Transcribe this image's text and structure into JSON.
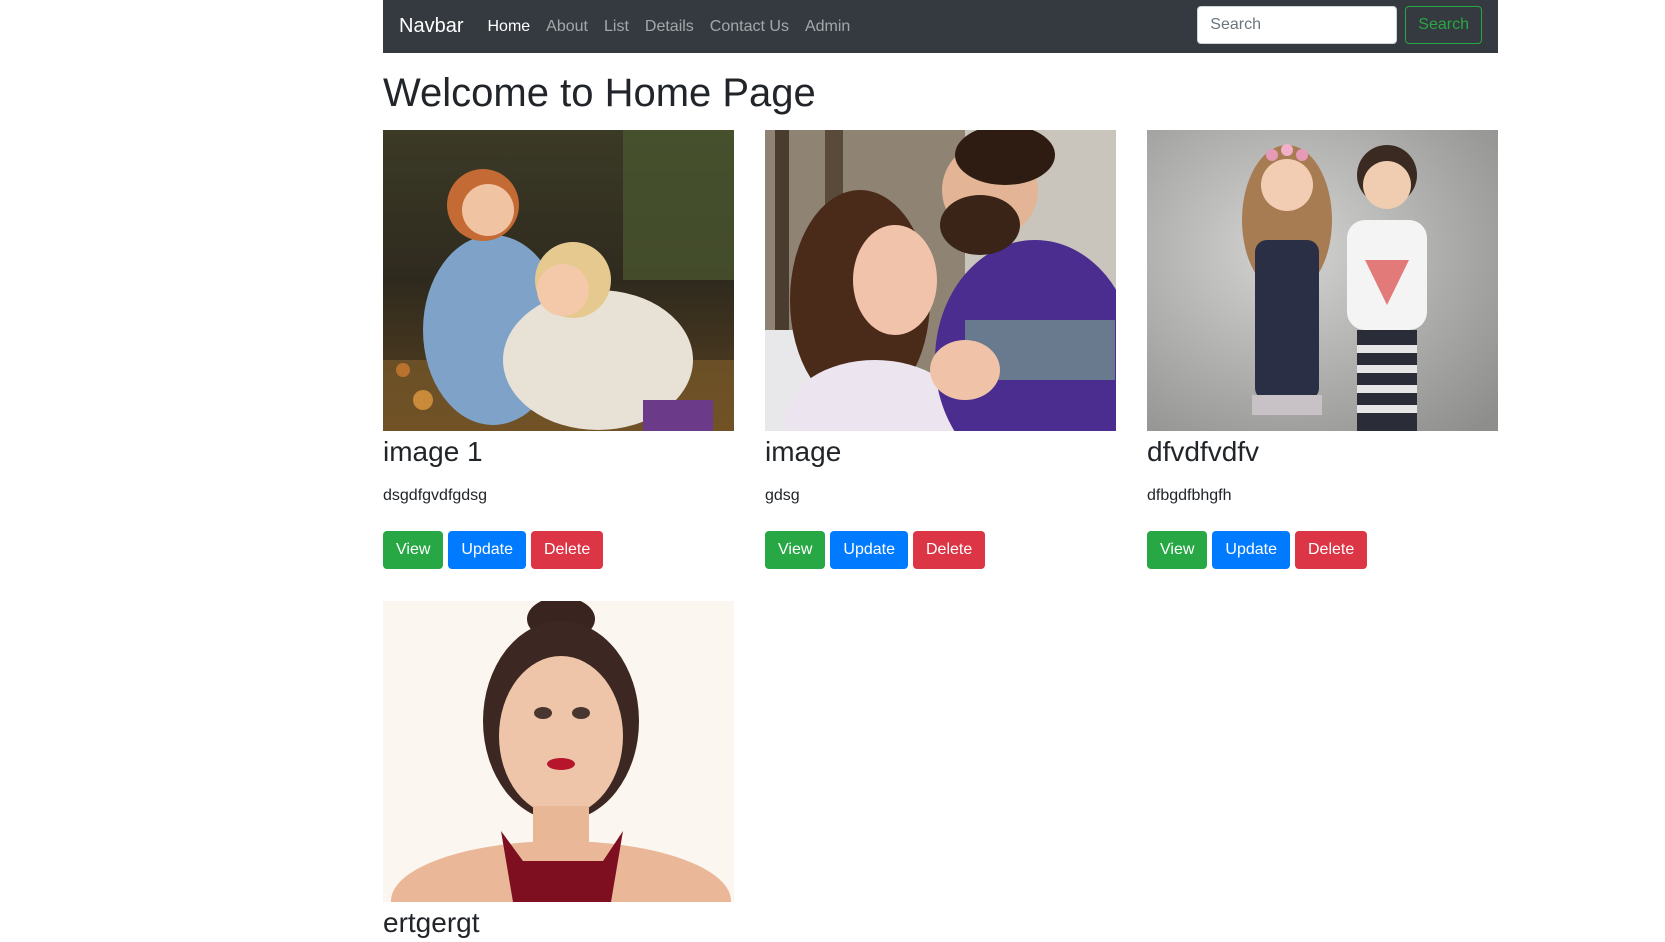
{
  "navbar": {
    "brand": "Navbar",
    "links": [
      "Home",
      "About",
      "List",
      "Details",
      "Contact Us",
      "Admin"
    ],
    "search_placeholder": "Search",
    "search_button": "Search"
  },
  "page": {
    "title": "Welcome to Home Page"
  },
  "cards": [
    {
      "title": "image 1",
      "text": "dsgdfgvdfgdsg",
      "view": "View",
      "update": "Update",
      "delete": "Delete"
    },
    {
      "title": "image",
      "text": "gdsg",
      "view": "View",
      "update": "Update",
      "delete": "Delete"
    },
    {
      "title": "dfvdfvdfv",
      "text": "dfbgdfbhgfh",
      "view": "View",
      "update": "Update",
      "delete": "Delete"
    },
    {
      "title": "ertgergt"
    }
  ],
  "colors": {
    "navbar_bg": "#343a40",
    "success": "#28a745",
    "primary": "#007bff",
    "danger": "#dc3545"
  }
}
